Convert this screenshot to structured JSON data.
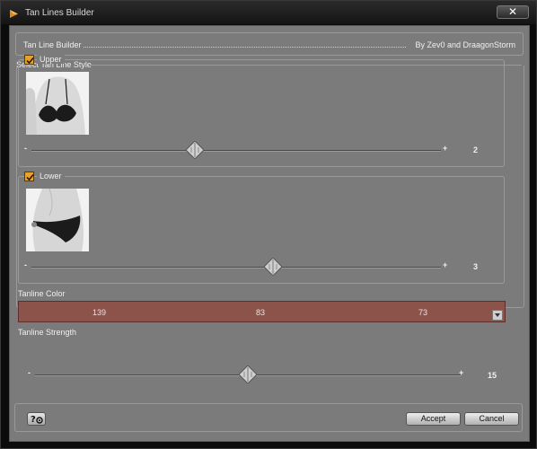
{
  "window": {
    "title": "Tan Lines Builder",
    "close_icon": "close-icon",
    "app_icon": "daz-icon"
  },
  "header": {
    "left": "Tan Line Builder",
    "right": "By Zev0 and DraagonStorm"
  },
  "section": {
    "label": "Select Tan Line Style"
  },
  "upper": {
    "checked": true,
    "label": "Upper",
    "thumbnail": "bikini-top-preview",
    "slider": {
      "min_label": "-",
      "max_label": "+",
      "value": "2",
      "fraction": 0.4
    }
  },
  "lower": {
    "checked": true,
    "label": "Lower",
    "thumbnail": "bikini-bottom-preview",
    "slider": {
      "min_label": "-",
      "max_label": "+",
      "value": "3",
      "fraction": 0.59
    }
  },
  "tanline_color": {
    "label": "Tanline Color",
    "r": "139",
    "g": "83",
    "b": "73",
    "swatch": "#8b5349"
  },
  "tanline_strength": {
    "label": "Tanline Strength",
    "slider": {
      "min_label": "-",
      "max_label": "+",
      "value": "15",
      "fraction": 0.5
    }
  },
  "footer": {
    "help_icon": "help-icon",
    "accept_label": "Accept",
    "cancel_label": "Cancel"
  }
}
